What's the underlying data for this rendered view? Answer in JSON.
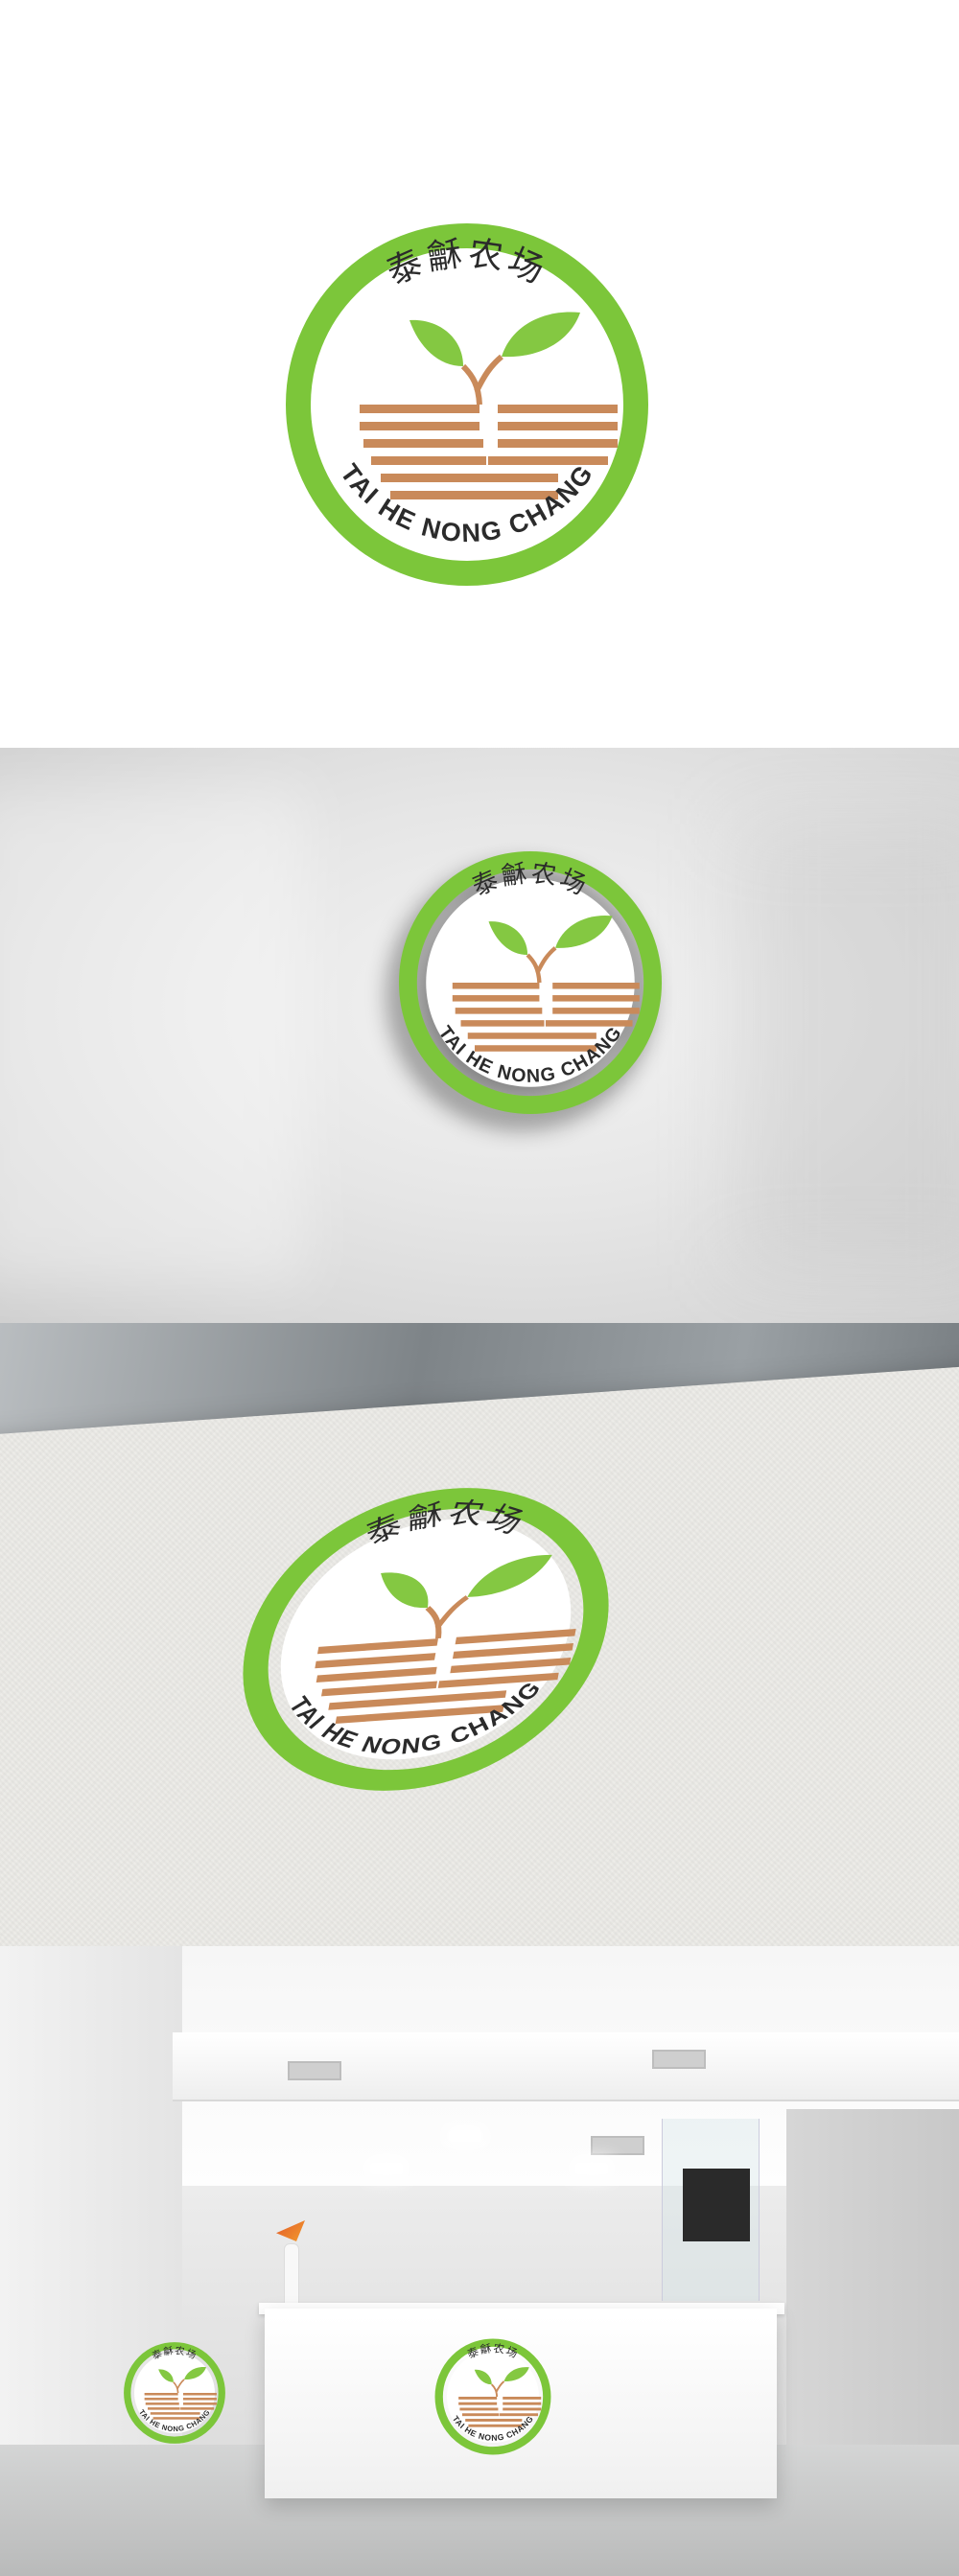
{
  "brand": {
    "chinese_name": "泰龢农场",
    "latin_name": "TAI HE NONG CHANG",
    "colors": {
      "ring_green": "#7cc63a",
      "leaf_green": "#84c842",
      "stripe_brown": "#c98a5a"
    },
    "logo_icon": "sprout-icon"
  },
  "mockups": [
    {
      "name": "plain-white"
    },
    {
      "name": "wall-sign"
    },
    {
      "name": "textured-paper"
    },
    {
      "name": "office-reception"
    }
  ]
}
